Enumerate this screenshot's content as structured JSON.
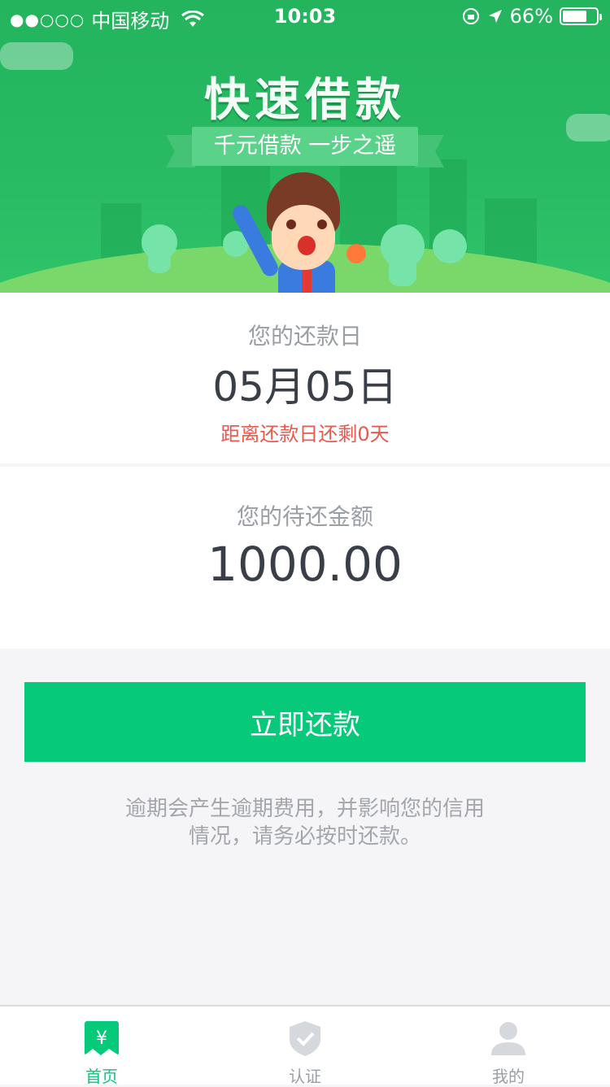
{
  "status_bar": {
    "signal": "●●○○○",
    "carrier": "中国移动",
    "time": "10:03",
    "battery": "66%"
  },
  "banner": {
    "title": "快速借款",
    "subtitle": "千元借款  一步之遥"
  },
  "repayment": {
    "date_label": "您的还款日",
    "date_value": "05月05日",
    "countdown": "距离还款日还剩0天",
    "amount_label": "您的待还金额",
    "amount_value": "1000.00"
  },
  "action": {
    "repay_button": "立即还款"
  },
  "notice": {
    "line1": "逾期会产生逾期费用，并影响您的信用",
    "line2": "情况，请务必按时还款。"
  },
  "tabbar": {
    "home": "首页",
    "home_icon_glyph": "¥",
    "verify": "认证",
    "mine": "我的"
  },
  "colors": {
    "brand_green": "#06c97a",
    "banner_green": "#28bb63",
    "countdown_red": "#e85a4d"
  }
}
